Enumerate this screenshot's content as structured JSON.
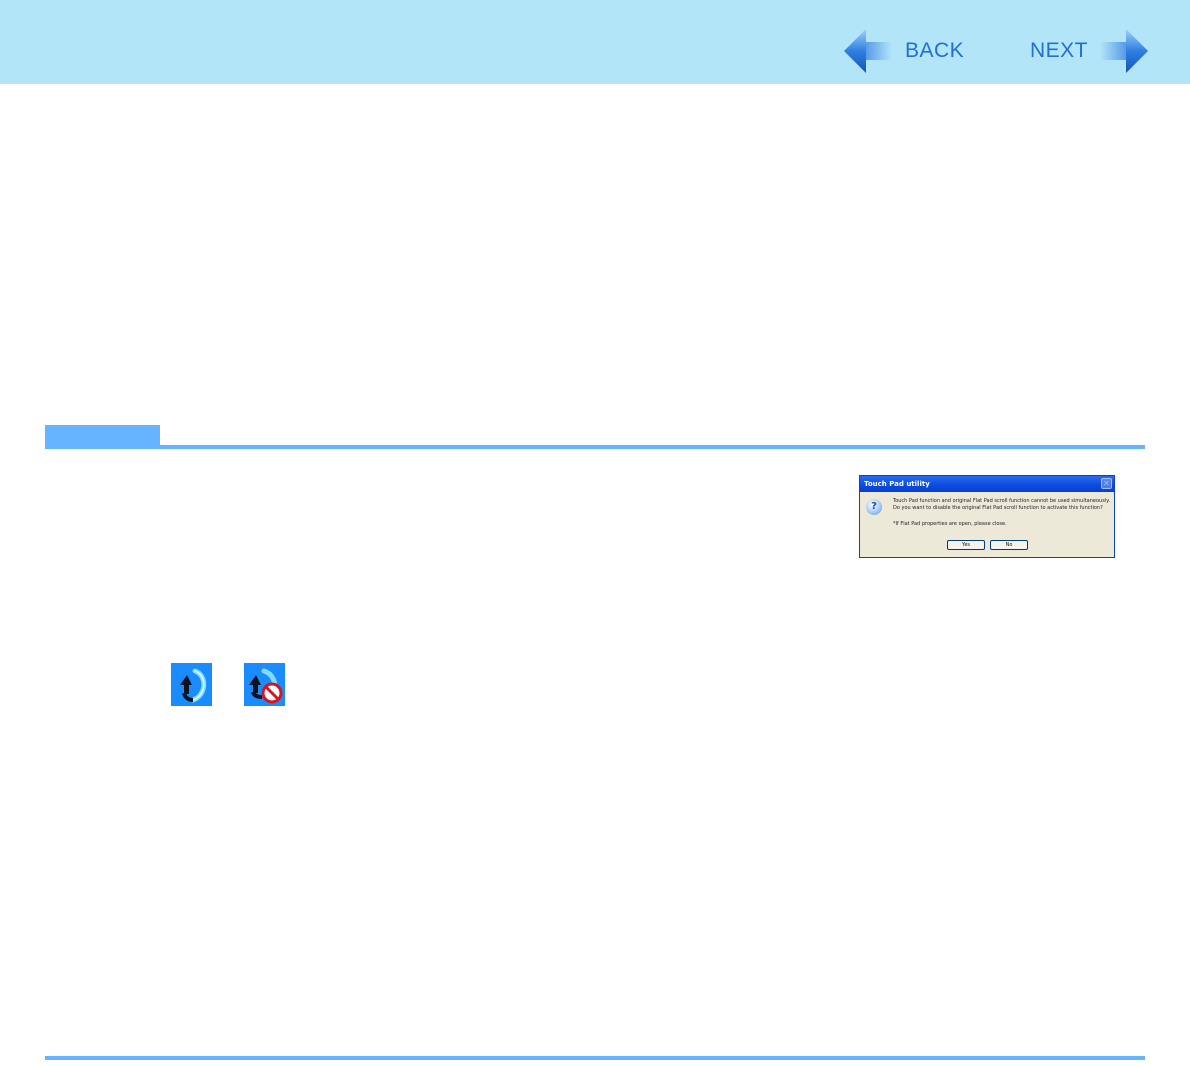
{
  "nav": {
    "back_label": "BACK",
    "next_label": "NEXT",
    "accent": "#1f6fd6",
    "header_bg": "#b3e5f8"
  },
  "section": {
    "bar_color": "#66b3ff"
  },
  "dialog": {
    "title": "Touch Pad utility",
    "message_line1": "Touch Pad function and original Flat Pad scroll function cannot be used simultaneously.",
    "message_line2": "Do you want to disable the original Flat Pad scroll function to activate this function?",
    "note": "*If Flat Pad properties are open, please close.",
    "yes_label": "Yes",
    "no_label": "No",
    "icon": "question-icon"
  },
  "tray_icons": [
    {
      "icon": "touch-pad-utility-enabled-icon"
    },
    {
      "icon": "touch-pad-utility-disabled-icon"
    }
  ]
}
